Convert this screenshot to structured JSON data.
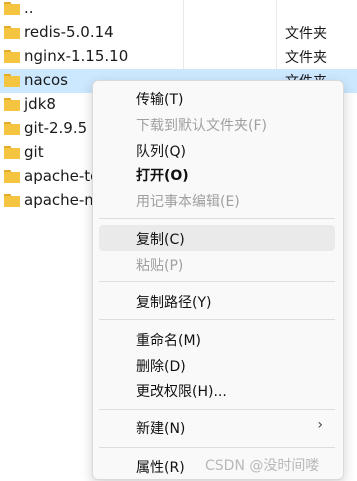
{
  "files": [
    {
      "name": "..",
      "type": "",
      "selected": false
    },
    {
      "name": "redis-5.0.14",
      "type": "文件夹",
      "selected": false
    },
    {
      "name": "nginx-1.15.10",
      "type": "文件夹",
      "selected": false
    },
    {
      "name": "nacos",
      "type": "文件夹",
      "selected": true
    },
    {
      "name": "jdk8",
      "type": "",
      "selected": false
    },
    {
      "name": "git-2.9.5",
      "type": "",
      "selected": false
    },
    {
      "name": "git",
      "type": "",
      "selected": false
    },
    {
      "name": "apache-to",
      "type": "",
      "selected": false
    },
    {
      "name": "apache-m",
      "type": "",
      "selected": false
    }
  ],
  "context_menu": {
    "groups": [
      [
        {
          "label": "传输(T)",
          "enabled": true
        },
        {
          "label": "下载到默认文件夹(F)",
          "enabled": false
        },
        {
          "label": "队列(Q)",
          "enabled": true
        },
        {
          "label": "打开(O)",
          "enabled": true,
          "bold": true
        },
        {
          "label": "用记事本编辑(E)",
          "enabled": false
        }
      ],
      [
        {
          "label": "复制(C)",
          "enabled": true,
          "hover": true
        },
        {
          "label": "粘贴(P)",
          "enabled": false
        }
      ],
      [
        {
          "label": "复制路径(Y)",
          "enabled": true
        }
      ],
      [
        {
          "label": "重命名(M)",
          "enabled": true
        },
        {
          "label": "删除(D)",
          "enabled": true
        },
        {
          "label": "更改权限(H)...",
          "enabled": true
        }
      ],
      [
        {
          "label": "新建(N)",
          "enabled": true,
          "submenu": true
        }
      ],
      [
        {
          "label": "属性(R)",
          "enabled": true
        }
      ]
    ],
    "submenu_arrow": "›"
  },
  "watermark": "CSDN @没时间喽",
  "colors": {
    "folder": "#f5c542",
    "selection": "#cce8ff",
    "hover": "#eaeaea",
    "disabled_text": "#a0a0a0"
  }
}
